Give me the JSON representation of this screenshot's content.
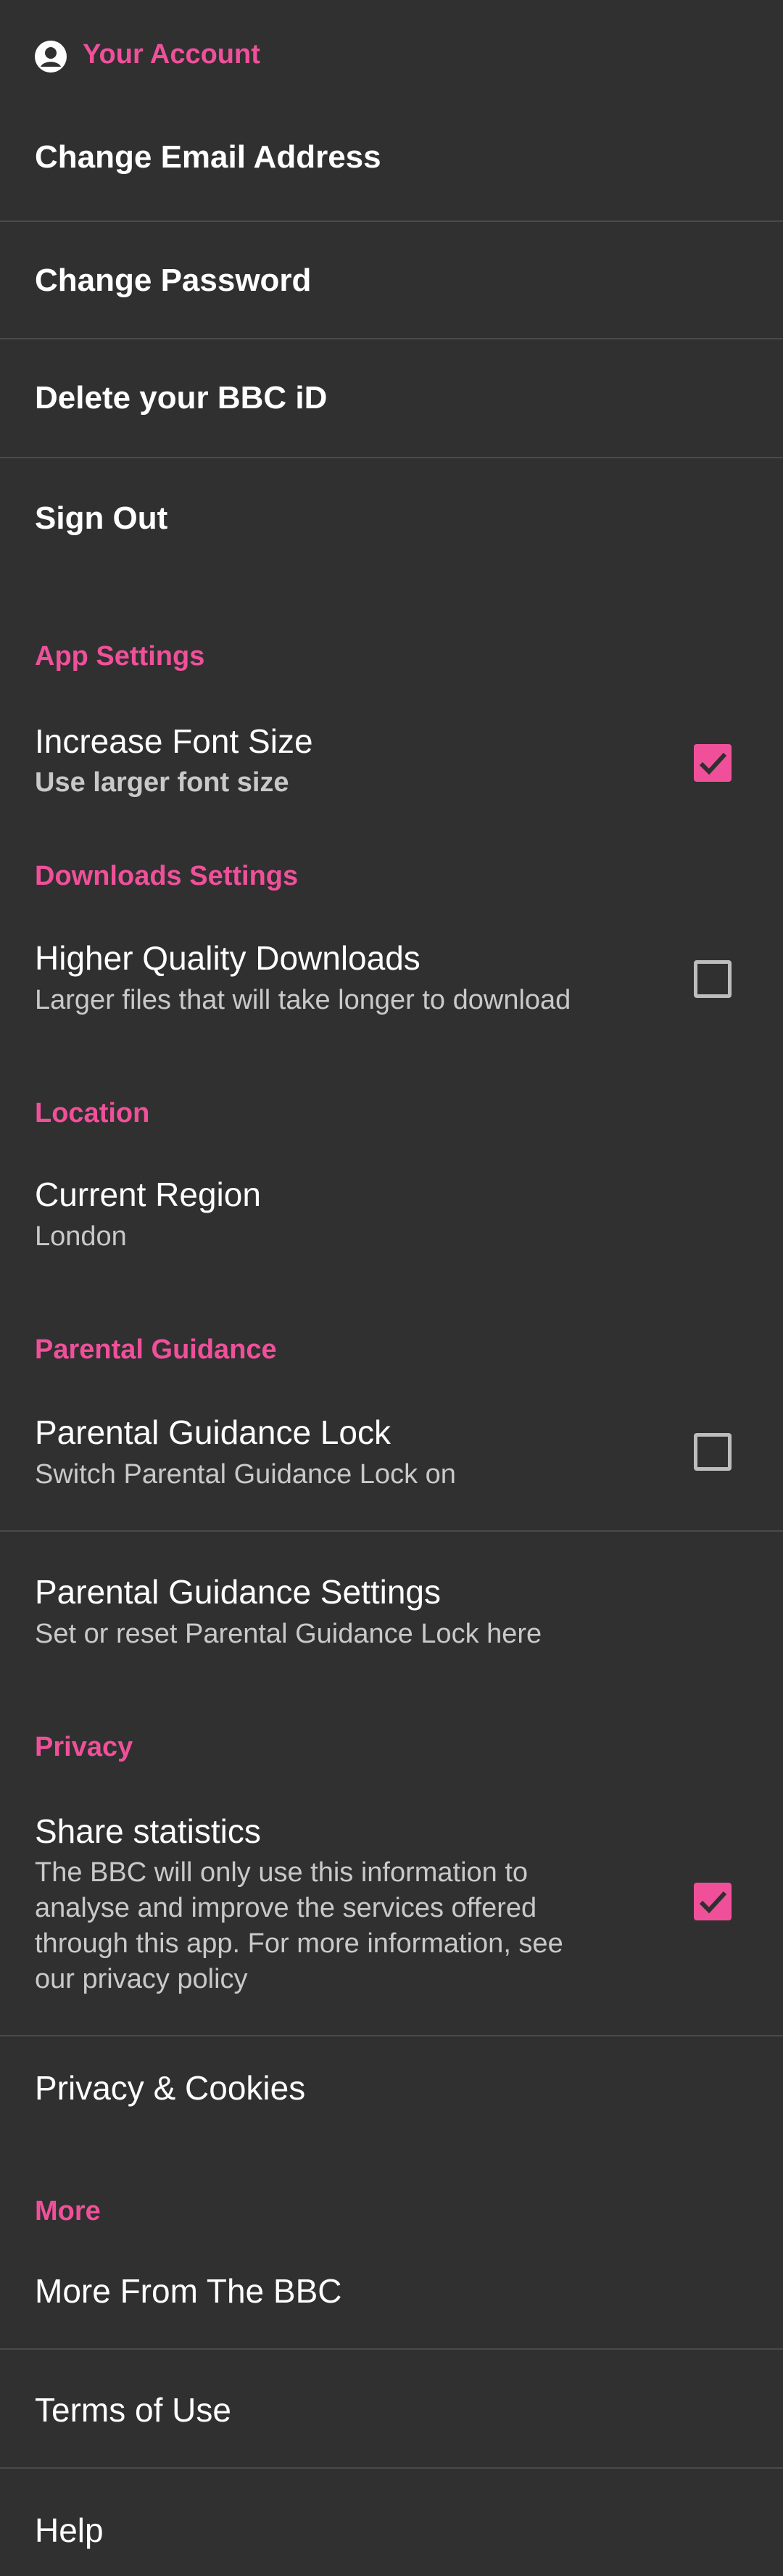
{
  "account": {
    "header": "Your Account",
    "items": [
      "Change Email Address",
      "Change Password",
      "Delete your BBC iD",
      "Sign Out"
    ]
  },
  "app_settings": {
    "header": "App Settings",
    "font_size": {
      "title": "Increase Font Size",
      "subtitle": "Use larger font size",
      "checked": true
    }
  },
  "downloads": {
    "header": "Downloads Settings",
    "quality": {
      "title": "Higher Quality Downloads",
      "subtitle": "Larger files that will take longer to download",
      "checked": false
    }
  },
  "location": {
    "header": "Location",
    "region": {
      "title": "Current Region",
      "value": "London"
    }
  },
  "parental": {
    "header": "Parental Guidance",
    "lock": {
      "title": "Parental Guidance Lock",
      "subtitle": "Switch Parental Guidance Lock on",
      "checked": false
    },
    "settings": {
      "title": "Parental Guidance Settings",
      "subtitle": "Set or reset Parental Guidance Lock here"
    }
  },
  "privacy": {
    "header": "Privacy",
    "share": {
      "title": "Share statistics",
      "line1": "The BBC will only use this information to",
      "line2": "analyse and improve the services offered",
      "line3": "through this app. For more information, see",
      "line4": "our privacy policy",
      "checked": true
    },
    "cookies": "Privacy & Cookies"
  },
  "more": {
    "header": "More",
    "items": [
      "More From The BBC",
      "Terms of Use",
      "Help"
    ]
  },
  "colors": {
    "accent": "#f0509a",
    "background": "#303030",
    "divider": "#4a4a4a"
  },
  "icons": {
    "account": "account-circle-icon",
    "check": "check-icon"
  }
}
